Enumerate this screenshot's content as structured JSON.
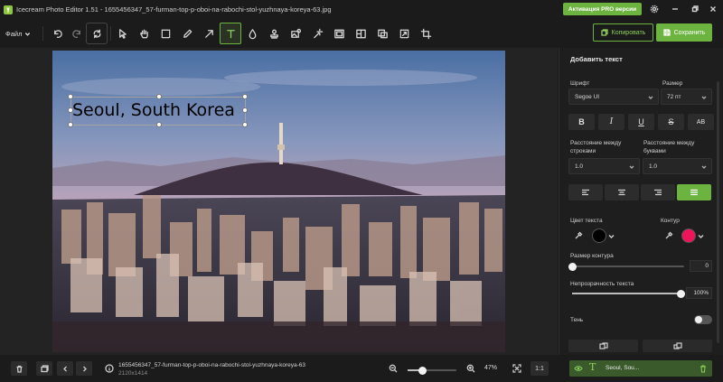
{
  "window": {
    "title": "Icecream Photo Editor 1.51 - 1655456347_57-furman-top-p-oboi-na-rabochi-stol-yuzhnaya-koreya-63.jpg",
    "pro_button": "Активация PRO версии"
  },
  "toolbar": {
    "file_menu": "Файл",
    "tools": [
      "undo-icon",
      "redo-icon",
      "reset-icon",
      "select-icon",
      "hand-icon",
      "crop-select-icon",
      "pen-icon",
      "arrow-icon",
      "text-icon",
      "drop-icon",
      "stamp-icon",
      "effects-icon",
      "magic-wand-icon",
      "frame-icon",
      "collage-icon",
      "adjust-icon",
      "resize-icon",
      "crop-icon"
    ],
    "active_tool": "text-icon",
    "copy_label": "Копировать",
    "save_label": "Сохранить"
  },
  "canvas": {
    "overlay_text": "Seoul, South Korea"
  },
  "panel": {
    "title": "Добавить текст",
    "font_label": "Шрифт",
    "font_value": "Segoe UI",
    "size_label": "Размер",
    "size_value": "72 пт",
    "format_buttons": [
      "B",
      "I",
      "U",
      "S",
      "AB"
    ],
    "line_spacing_label": "Расстояние между строками",
    "line_spacing_value": "1.0",
    "letter_spacing_label": "Расстояние между буквами",
    "letter_spacing_value": "1.0",
    "alignments": [
      "left",
      "center",
      "right",
      "justify"
    ],
    "active_alignment": "justify",
    "text_color_label": "Цвет текста",
    "text_color": "#000000",
    "outline_label": "Контур",
    "outline_color": "#f0145a",
    "outline_size_label": "Размер контура",
    "outline_size_value": "0",
    "outline_size_fraction": 0.0,
    "opacity_label": "Непрозрачность текста",
    "opacity_value": "100%",
    "opacity_fraction": 1.0,
    "shadow_label": "Тень",
    "shadow_enabled": false
  },
  "layers": {
    "items": [
      {
        "icon": "T",
        "name": "Seoul, Sou..."
      }
    ]
  },
  "statusbar": {
    "file_name": "1655456347_57-furman-top-p-oboi-na-rabochi-stol-yuzhnaya-koreya-63",
    "dimensions": "2120x1414",
    "zoom": "47%",
    "actual_size": "1:1",
    "zoom_fraction": 0.3
  },
  "colors": {
    "accent": "#6db33f",
    "background": "#1b1b1b",
    "panel": "#1e1e1e"
  }
}
